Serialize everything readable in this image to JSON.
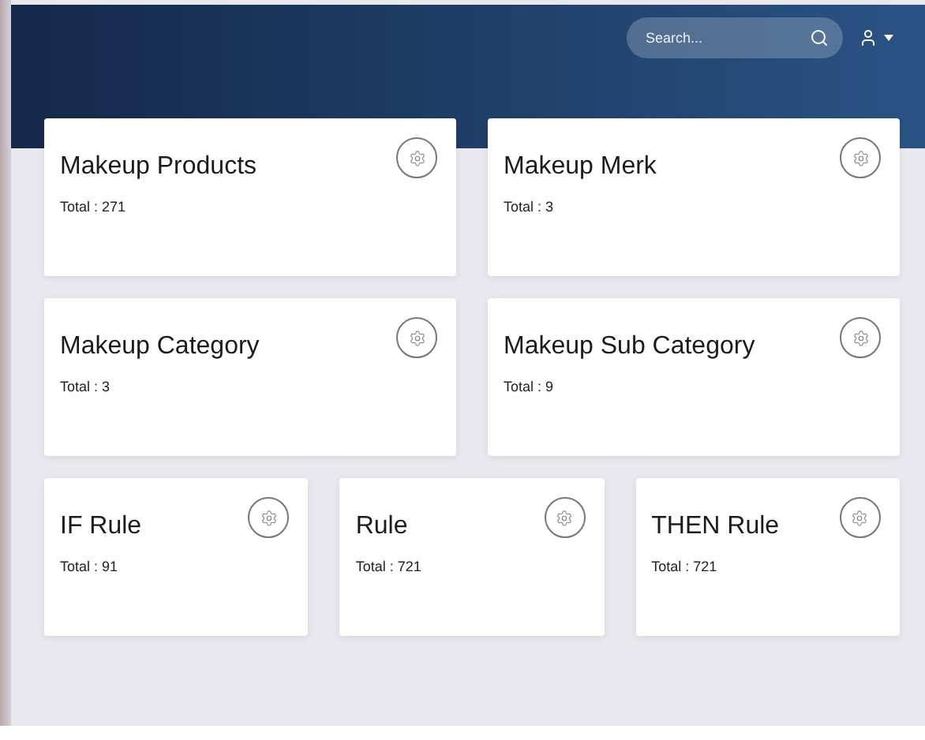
{
  "search": {
    "placeholder": "Search..."
  },
  "rows": [
    [
      {
        "title": "Makeup Products",
        "total": "Total : 271"
      },
      {
        "title": "Makeup Merk",
        "total": "Total : 3"
      }
    ],
    [
      {
        "title": "Makeup Category",
        "total": "Total : 3"
      },
      {
        "title": "Makeup Sub Category",
        "total": "Total : 9"
      }
    ],
    [
      {
        "title": "IF Rule",
        "total": "Total : 91"
      },
      {
        "title": "Rule",
        "total": "Total : 721"
      },
      {
        "title": "THEN Rule",
        "total": "Total : 721"
      }
    ]
  ]
}
